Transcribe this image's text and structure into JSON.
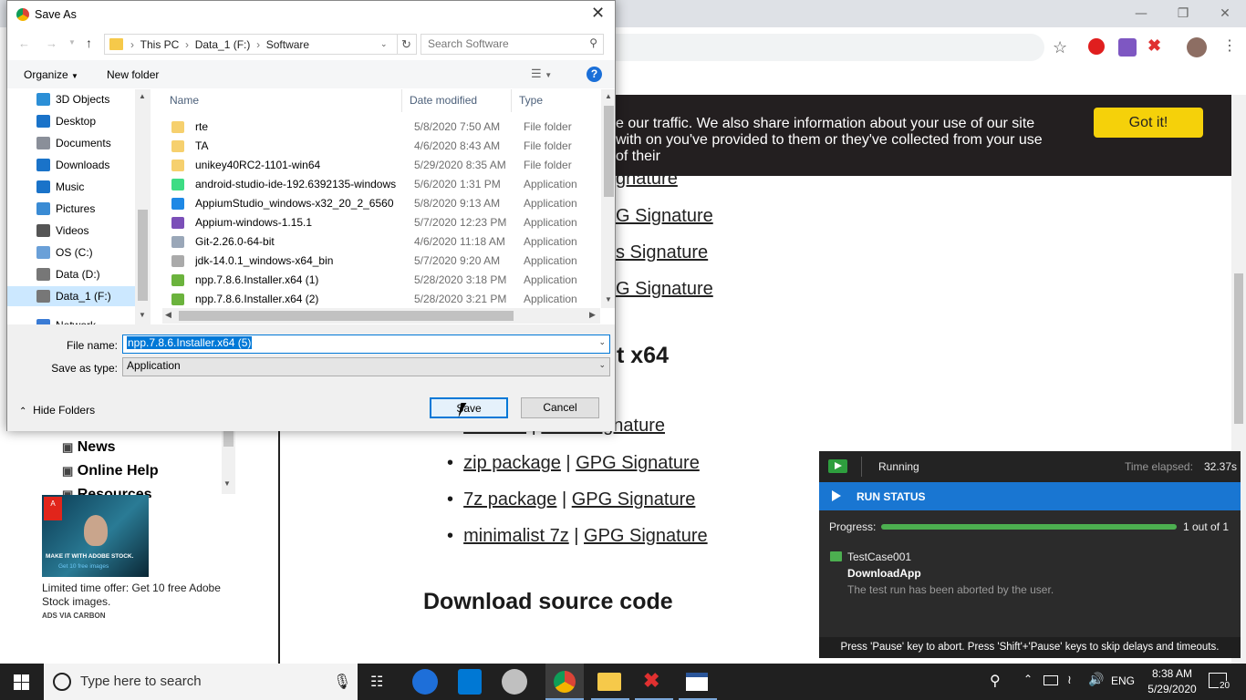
{
  "dialog": {
    "title": "Save As",
    "breadcrumb": [
      "This PC",
      "Data_1 (F:)",
      "Software"
    ],
    "search_placeholder": "Search Software",
    "organize_label": "Organize",
    "new_folder_label": "New folder",
    "tree": [
      {
        "label": "3D Objects",
        "color": "#2c8fd6"
      },
      {
        "label": "Desktop",
        "color": "#1a73c9"
      },
      {
        "label": "Documents",
        "color": "#8a8f99"
      },
      {
        "label": "Downloads",
        "color": "#1a73c9"
      },
      {
        "label": "Music",
        "color": "#1a73c9"
      },
      {
        "label": "Pictures",
        "color": "#3a8bd4"
      },
      {
        "label": "Videos",
        "color": "#555"
      },
      {
        "label": "OS (C:)",
        "color": "#6aa0d8"
      },
      {
        "label": "Data (D:)",
        "color": "#777"
      },
      {
        "label": "Data_1 (F:)",
        "color": "#777"
      },
      {
        "label": "Network",
        "color": "#3a7bd5"
      }
    ],
    "columns": {
      "name": "Name",
      "date": "Date modified",
      "type": "Type"
    },
    "files": [
      {
        "name": "rte",
        "date": "5/8/2020 7:50 AM",
        "type": "File folder",
        "icon": "folder-icon",
        "color": "#f6d06e"
      },
      {
        "name": "TA",
        "date": "4/6/2020 8:43 AM",
        "type": "File folder",
        "icon": "folder-icon",
        "color": "#f6d06e"
      },
      {
        "name": "unikey40RC2-1101-win64",
        "date": "5/29/2020 8:35 AM",
        "type": "File folder",
        "icon": "folder-icon",
        "color": "#f6d06e"
      },
      {
        "name": "android-studio-ide-192.6392135-windows",
        "date": "5/6/2020 1:31 PM",
        "type": "Application",
        "icon": "android-studio-icon",
        "color": "#3ddc84"
      },
      {
        "name": "AppiumStudio_windows-x32_20_2_6560",
        "date": "5/8/2020 9:13 AM",
        "type": "Application",
        "icon": "appium-studio-icon",
        "color": "#1e88e5"
      },
      {
        "name": "Appium-windows-1.15.1",
        "date": "5/7/2020 12:23 PM",
        "type": "Application",
        "icon": "appium-icon",
        "color": "#7b4fb8"
      },
      {
        "name": "Git-2.26.0-64-bit",
        "date": "4/6/2020 11:18 AM",
        "type": "Application",
        "icon": "git-icon",
        "color": "#9aa7b8"
      },
      {
        "name": "jdk-14.0.1_windows-x64_bin",
        "date": "5/7/2020 9:20 AM",
        "type": "Application",
        "icon": "jdk-icon",
        "color": "#aaaaaa"
      },
      {
        "name": "npp.7.8.6.Installer.x64 (1)",
        "date": "5/28/2020 3:18 PM",
        "type": "Application",
        "icon": "notepad-plus-icon",
        "color": "#6bb33d"
      },
      {
        "name": "npp.7.8.6.Installer.x64 (2)",
        "date": "5/28/2020 3:21 PM",
        "type": "Application",
        "icon": "notepad-plus-icon",
        "color": "#6bb33d"
      }
    ],
    "file_name_label": "File name:",
    "file_name_value": "npp.7.8.6.Installer.x64 (5)",
    "save_type_label": "Save as type:",
    "save_type_value": "Application",
    "hide_folders_label": "Hide Folders",
    "save_button": "Save",
    "cancel_button": "Cancel"
  },
  "page": {
    "cookie_text": "e our traffic. We also share information about your use of our site with on you've provided to them or they've collected from your use of their",
    "got_it": "Got it!",
    "links_top": [
      {
        "a": "gnature",
        "b": ""
      },
      {
        "a": "G Signature",
        "b": ""
      },
      {
        "a": "s Signature",
        "b": ""
      },
      {
        "a": "G Signature",
        "b": ""
      }
    ],
    "heading_x64": "t x64",
    "downloads": [
      {
        "a": "installer",
        "b": "GPG Signature"
      },
      {
        "a": "zip package",
        "b": "GPG Signature"
      },
      {
        "a": "7z package",
        "b": "GPG Signature"
      },
      {
        "a": "minimalist 7z",
        "b": "GPG Signature"
      }
    ],
    "source_heading": "Download source code",
    "side_links": [
      "News",
      "Online Help",
      "Resources"
    ],
    "ad_caption": "Limited time offer: Get 10 free Adobe Stock images.",
    "ad_tag": "ADS VIA CARBON",
    "ad_text1": "MAKE IT WITH ADOBE STOCK.",
    "ad_text2": "Get 10 free images"
  },
  "run_status": {
    "state": "Running",
    "elapsed_label": "Time elapsed:",
    "elapsed": "32.37s",
    "header": "RUN STATUS",
    "progress_label": "Progress:",
    "progress_fraction": 1.0,
    "progress_text": "1 out of 1",
    "test_case": "TestCase001",
    "app": "DownloadApp",
    "message": "The test run has been aborted by the user.",
    "footer": "Press 'Pause' key to abort. Press 'Shift'+'Pause' keys to skip delays and timeouts."
  },
  "taskbar": {
    "search_placeholder": "Type here to search",
    "language": "ENG",
    "time": "8:38 AM",
    "date": "5/29/2020",
    "notifications": "20"
  }
}
